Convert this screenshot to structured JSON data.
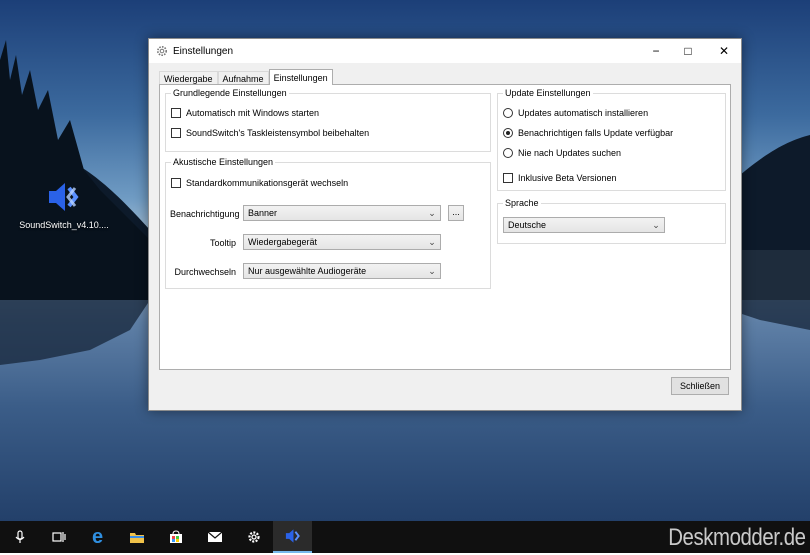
{
  "desktop": {
    "icon_label": "SoundSwitch_v4.10....",
    "watermark": "Deskmodder.de"
  },
  "window": {
    "title": "Einstellungen",
    "controls": {
      "minimize": "−",
      "maximize": "□",
      "close": "✕"
    },
    "tabs": [
      {
        "label": "Wiedergabe",
        "selected": false
      },
      {
        "label": "Aufnahme",
        "selected": false
      },
      {
        "label": "Einstellungen",
        "selected": true
      }
    ],
    "basic_settings": {
      "legend": "Grundlegende Einstellungen",
      "autostart": {
        "label": "Automatisch mit Windows starten",
        "checked": false
      },
      "keep_tray_icon": {
        "label": "SoundSwitch's Taskleistensymbol beibehalten",
        "checked": false
      }
    },
    "acoustic_settings": {
      "legend": "Akustische Einstellungen",
      "change_comm_device": {
        "label": "Standardkommunikationsgerät wechseln",
        "checked": false
      },
      "notification": {
        "label": "Benachrichtigung",
        "value": "Banner",
        "browse": "..."
      },
      "tooltip": {
        "label": "Tooltip",
        "value": "Wiedergabegerät"
      },
      "cycle": {
        "label": "Durchwechseln",
        "value": "Nur ausgewählte Audiogeräte"
      }
    },
    "update_settings": {
      "legend": "Update Einstellungen",
      "options": [
        {
          "label": "Updates automatisch installieren",
          "checked": false
        },
        {
          "label": "Benachrichtigen falls Update verfügbar",
          "checked": true
        },
        {
          "label": "Nie nach Updates suchen",
          "checked": false
        }
      ],
      "beta": {
        "label": "Inklusive Beta Versionen",
        "checked": false
      }
    },
    "language": {
      "legend": "Sprache",
      "value": "Deutsche"
    },
    "close_button": "Schließen"
  },
  "taskbar": {
    "icons": [
      "microphone-icon",
      "task-view-icon",
      "edge-icon",
      "file-explorer-icon",
      "store-icon",
      "mail-icon",
      "settings-icon",
      "soundswitch-icon"
    ]
  },
  "colors": {
    "accent": "#76b9ed",
    "taskbar": "#101010",
    "dialog_bg": "#f0f0f0"
  }
}
